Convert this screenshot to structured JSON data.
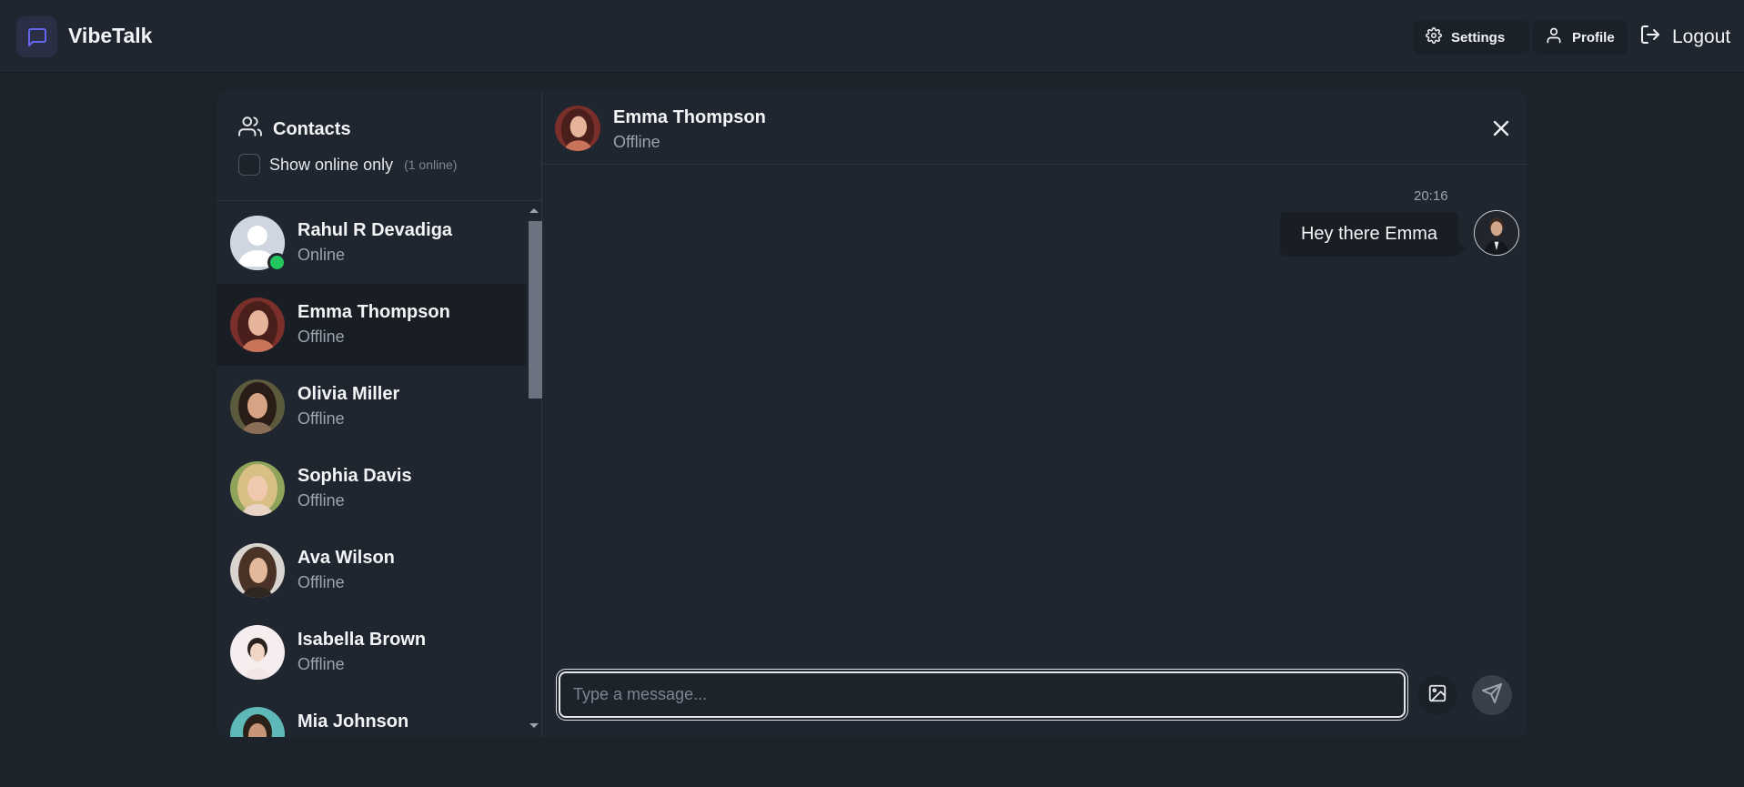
{
  "app": {
    "title": "VibeTalk"
  },
  "header": {
    "settings_label": "Settings",
    "profile_label": "Profile",
    "logout_label": "Logout"
  },
  "sidebar": {
    "title": "Contacts",
    "filter_label": "Show online only",
    "online_count": "(1 online)",
    "contacts": [
      {
        "name": "Rahul R Devadiga",
        "status": "Online",
        "online": true
      },
      {
        "name": "Emma Thompson",
        "status": "Offline",
        "active": true
      },
      {
        "name": "Olivia Miller",
        "status": "Offline"
      },
      {
        "name": "Sophia Davis",
        "status": "Offline"
      },
      {
        "name": "Ava Wilson",
        "status": "Offline"
      },
      {
        "name": "Isabella Brown",
        "status": "Offline"
      },
      {
        "name": "Mia Johnson",
        "status": ""
      }
    ]
  },
  "chat": {
    "name": "Emma Thompson",
    "status": "Offline",
    "messages": [
      {
        "time": "20:16",
        "text": "Hey there Emma",
        "from_me": true
      }
    ],
    "input_placeholder": "Type a message..."
  },
  "colors": {
    "accent": "#6366f1",
    "online": "#22c55e",
    "background": "#1d232a",
    "panel": "#1f2630"
  }
}
